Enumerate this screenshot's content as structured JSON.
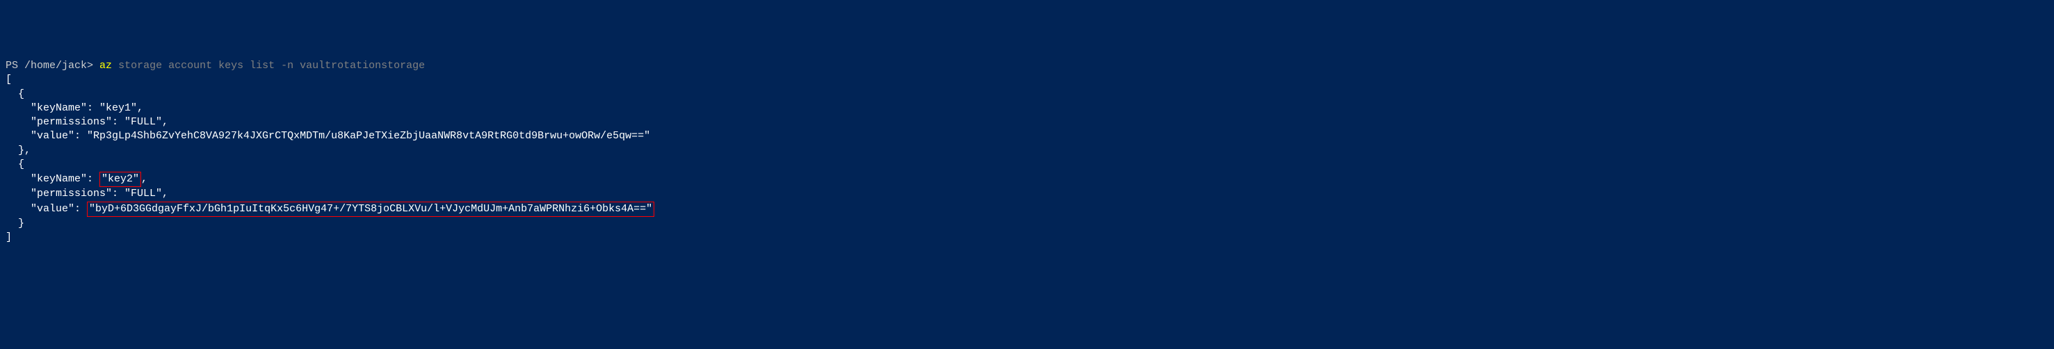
{
  "prompt": {
    "ps": "PS ",
    "path": "/home/jack> ",
    "cmd_az": "az",
    "cmd_rest": " storage account keys list ",
    "cmd_flag": "-n",
    "cmd_arg": " vaultrotationstorage"
  },
  "output": {
    "bracket_open": "[",
    "brace_open1": "  {",
    "key1_keyname": "    \"keyName\": ",
    "key1_keyname_val": "\"key1\"",
    "key1_keyname_end": ",",
    "key1_permissions": "    \"permissions\": \"FULL\",",
    "key1_value": "    \"value\": \"Rp3gLp4Shb6ZvYehC8VA927k4JXGrCTQxMDTm/u8KaPJeTXieZbjUaaNWR8vtA9RtRG0td9Brwu+owORw/e5qw==\"",
    "brace_close1": "  },",
    "brace_open2": "  {",
    "key2_keyname": "    \"keyName\": ",
    "key2_keyname_val": "\"key2\"",
    "key2_keyname_end": ",",
    "key2_permissions": "    \"permissions\": \"FULL\",",
    "key2_value_label": "    \"value\": ",
    "key2_value_val": "\"byD+6D3GGdgayFfxJ/bGh1pIuItqKx5c6HVg47+/7YTS8joCBLXVu/l+VJycMdUJm+Anb7aWPRNhzi6+Obks4A==\"",
    "brace_close2": "  }",
    "bracket_close": "]"
  }
}
